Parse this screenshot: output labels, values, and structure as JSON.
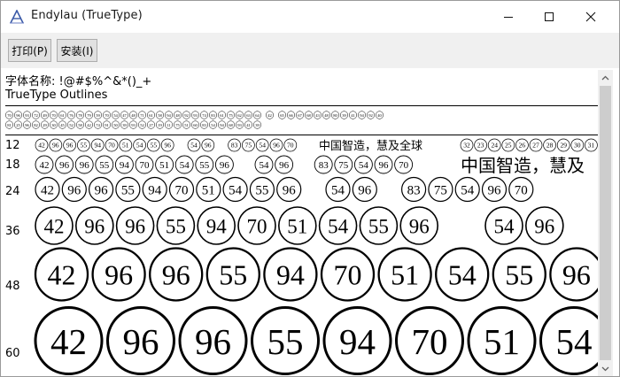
{
  "window": {
    "title": "Endylau (TrueType)",
    "icon": "font-a-icon"
  },
  "toolbar": {
    "print_label": "打印(P)",
    "install_label": "安装(I)"
  },
  "info": {
    "charset_line": "字体名称: !@#$%^&*()_+",
    "outline_line": "TrueType Outlines"
  },
  "sample_strip": {
    "glyphs": [
      "70",
      "96",
      "93",
      "72",
      "49",
      "70",
      "61",
      "76",
      "78",
      "79",
      "59",
      "70",
      "54",
      "47",
      "48",
      "71",
      "61",
      "58",
      "94",
      "48",
      "92",
      "93",
      "74",
      "83",
      "61",
      "75",
      "62",
      "63",
      "64",
      "42",
      "65",
      "66",
      "67",
      "68",
      "43",
      "48",
      "80",
      "39",
      "41",
      "94",
      "92",
      "40",
      "81",
      "25",
      "96",
      "82",
      "29",
      "30",
      "45",
      "52",
      "58",
      "42",
      "74",
      "91",
      "50",
      "39",
      "93",
      "52",
      "27",
      "19",
      "11",
      "75",
      "51",
      "60",
      "83",
      "54",
      "94",
      "68",
      "93",
      "41",
      "39"
    ]
  },
  "samples": [
    {
      "size_label": "12",
      "glyphs": [
        "42",
        "96",
        "96",
        "55",
        "94",
        "70",
        "51",
        "54",
        "55",
        "96",
        "",
        "54",
        "96",
        "",
        "83",
        "75",
        "54",
        "96",
        "70"
      ],
      "chinese": "中国智造，慧及全球",
      "tail": [
        "32",
        "23",
        "24",
        "25",
        "26",
        "27",
        "28",
        "29",
        "30",
        "31"
      ]
    },
    {
      "size_label": "18",
      "glyphs": [
        "42",
        "96",
        "96",
        "55",
        "94",
        "70",
        "51",
        "54",
        "55",
        "96",
        "",
        "54",
        "96",
        "",
        "83",
        "75",
        "54",
        "96",
        "70"
      ],
      "chinese": "中国智造，慧及"
    },
    {
      "size_label": "24",
      "glyphs": [
        "42",
        "96",
        "96",
        "55",
        "94",
        "70",
        "51",
        "54",
        "55",
        "96",
        "",
        "54",
        "96",
        "",
        "83",
        "75",
        "54",
        "96",
        "70"
      ]
    },
    {
      "size_label": "36",
      "glyphs": [
        "42",
        "96",
        "96",
        "55",
        "94",
        "70",
        "51",
        "54",
        "55",
        "96",
        "",
        "54",
        "96"
      ]
    },
    {
      "size_label": "48",
      "glyphs": [
        "42",
        "96",
        "96",
        "55",
        "94",
        "70",
        "51",
        "54",
        "55",
        "96"
      ]
    },
    {
      "size_label": "60",
      "glyphs": [
        "42",
        "96",
        "96",
        "55",
        "94",
        "70",
        "51",
        "54"
      ]
    }
  ],
  "colors": {
    "titlebar_bg": "#ffffff",
    "toolbar_bg": "#f0f0f0",
    "button_bg": "#e1e1e1",
    "button_border": "#adadad",
    "text": "#000000",
    "scrollbar_thumb": "#cdcdcd"
  }
}
